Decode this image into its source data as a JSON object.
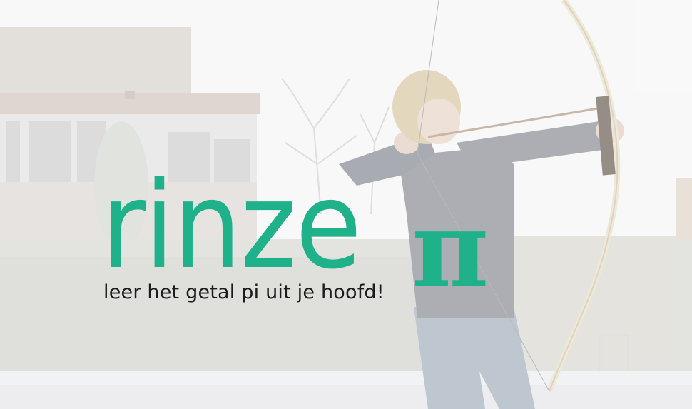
{
  "brand": {
    "wordmark": "rinze",
    "symbol": "π",
    "accent_color": "#1fb28a"
  },
  "tagline": "leer het getal pi uit je hoofd!",
  "background_photo": {
    "subject": "boy-with-bow-icon"
  }
}
